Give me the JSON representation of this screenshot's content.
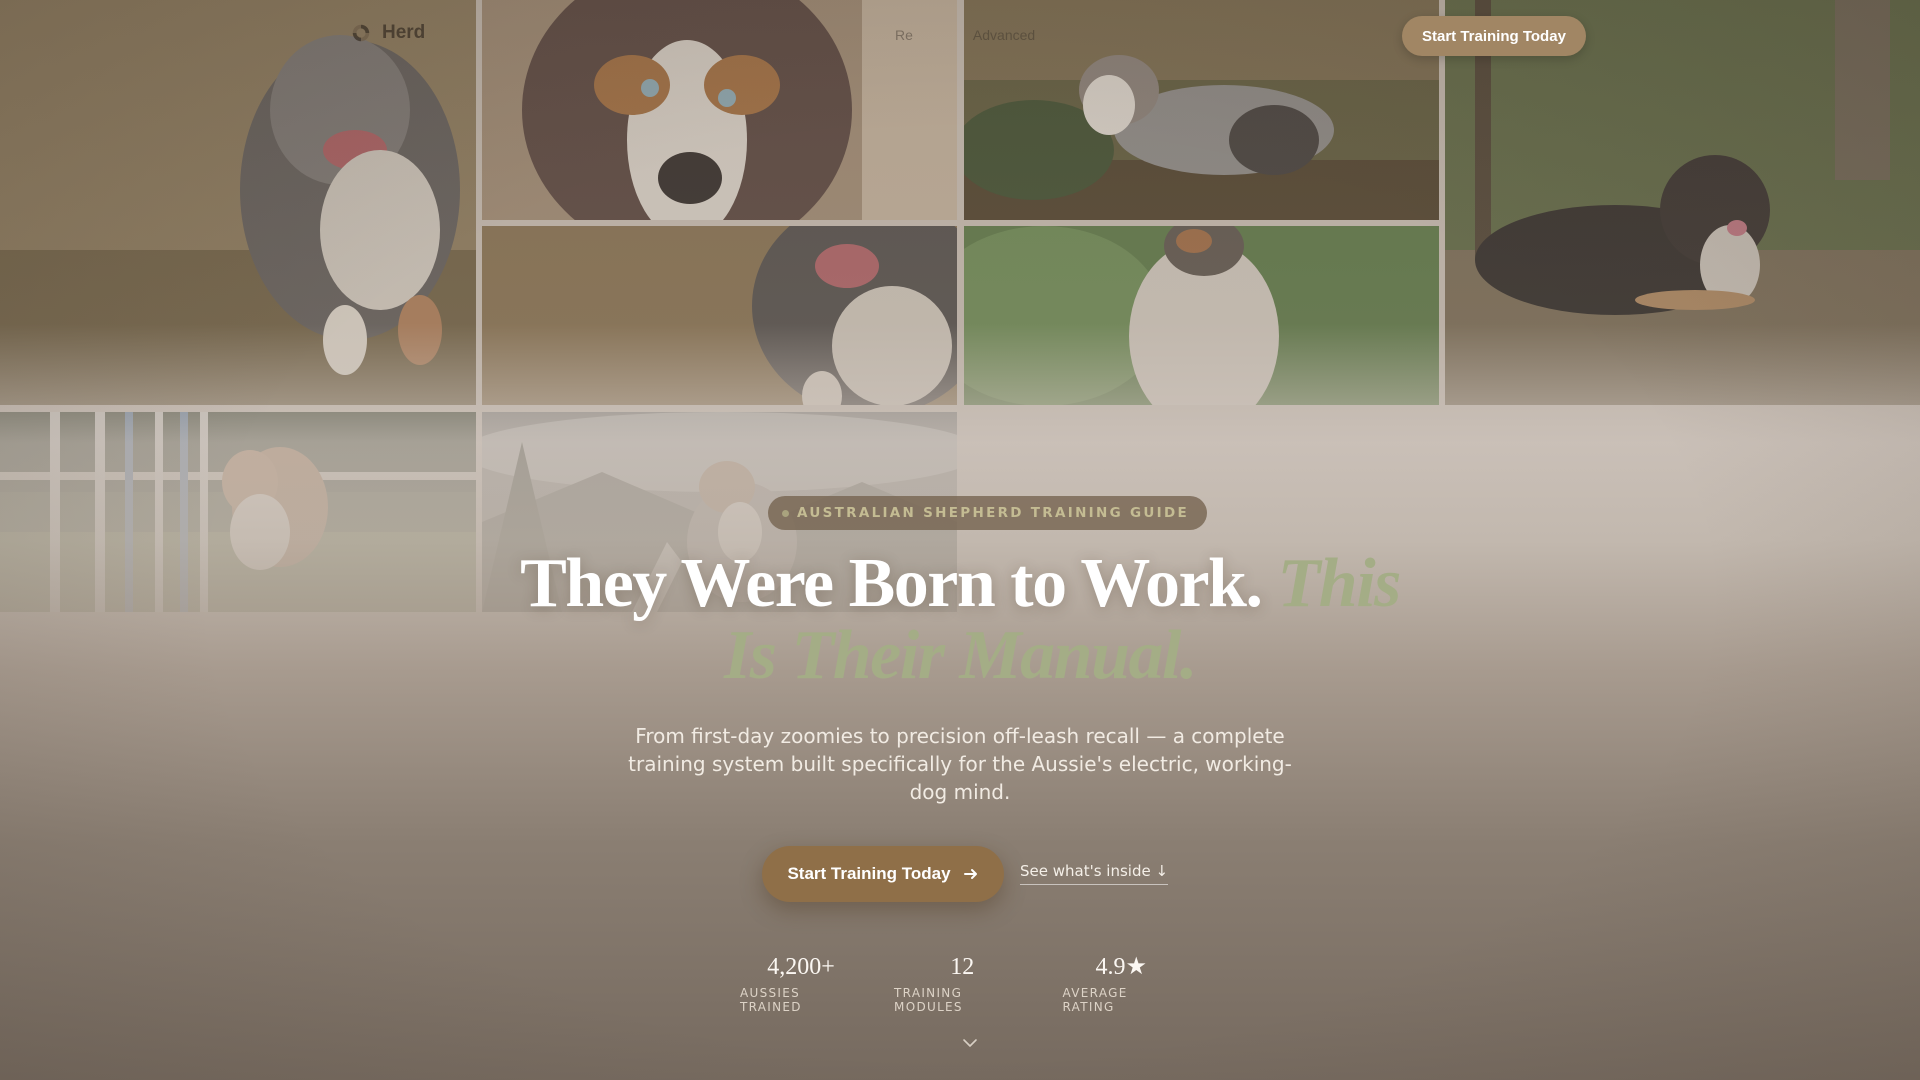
{
  "nav": {
    "brand": "Herd",
    "links": [
      "Re",
      "Advanced"
    ],
    "cta": "Start Training Today"
  },
  "hero": {
    "badge": "AUSTRALIAN SHEPHERD TRAINING GUIDE",
    "headline_main": "They Were Born to Work.",
    "headline_accent": "This Is Their Manual.",
    "subtitle": "From first-day zoomies to precision off-leash recall — a complete training system built specifically for the Aussie's electric, working-dog mind.",
    "cta_primary": "Start Training Today",
    "cta_secondary": "See what's inside ↓"
  },
  "stats": [
    {
      "value": "4,200+",
      "label": "AUSSIES TRAINED"
    },
    {
      "value": "12",
      "label": "TRAINING MODULES"
    },
    {
      "value": "4.9★",
      "label": "AVERAGE RATING"
    }
  ],
  "colors": {
    "accent_brown": "#8f6f48",
    "accent_green": "#a4ad86",
    "badge_bg": "#76644f"
  },
  "icons": [
    "brand-logo-icon",
    "arrow-right-icon",
    "chevron-down-icon"
  ]
}
